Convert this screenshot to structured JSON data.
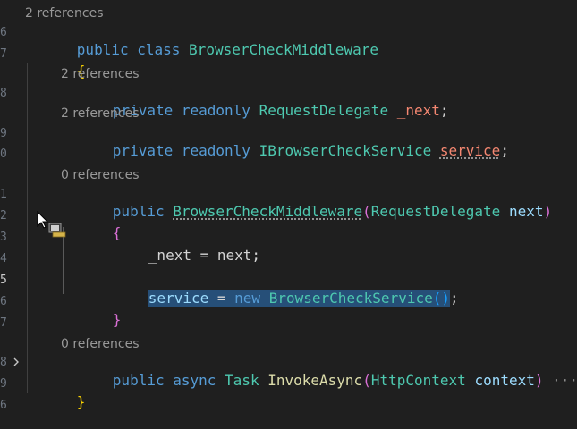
{
  "gutter": {
    "line_numbers": [
      "6",
      "7",
      "8",
      "9",
      "0",
      "1",
      "2",
      "3",
      "4",
      "5",
      "6",
      "7",
      "8",
      "9"
    ],
    "active_line": "5"
  },
  "codelens": {
    "class_refs": "2 references",
    "next_refs": "2 references",
    "service_refs": "2 references",
    "ctor_refs": "0 references",
    "invoke_refs": "0 references"
  },
  "code": {
    "class_kw1": "public",
    "class_kw2": "class",
    "class_name": "BrowserCheckMiddleware",
    "open_brace": "{",
    "close_brace": "}",
    "f1_kw1": "private",
    "f1_kw2": "readonly",
    "f1_type": "RequestDelegate",
    "f1_name": "_next",
    "semi": ";",
    "f2_type": "IBrowserCheckService",
    "f2_name": "service",
    "ctor_kw": "public",
    "ctor_name": "BrowserCheckMiddleware",
    "ctor_param_type": "RequestDelegate",
    "ctor_param_name": "next",
    "lparen": "(",
    "rparen": ")",
    "assign_lhs": "_next",
    "equals": "=",
    "assign_rhs": "next",
    "service_lhs": "service",
    "new_kw": "new",
    "service_ctor": "BrowserCheckService",
    "empty_parens": "()",
    "invoke_kw1": "public",
    "invoke_kw2": "async",
    "invoke_type": "Task",
    "invoke_name": "InvokeAsync",
    "invoke_param_type": "HttpContext",
    "invoke_param_name": "context",
    "folded_ellipsis": "···"
  },
  "icons": {
    "fold": "chevron-right-icon",
    "cursor": "mouse-pointer-icon"
  },
  "colors": {
    "background": "#1f1f1f",
    "keyword": "#569cd6",
    "type": "#4ec9b0",
    "variable": "#9cdcfe",
    "method": "#dcdcaa",
    "selection": "#264f78"
  }
}
